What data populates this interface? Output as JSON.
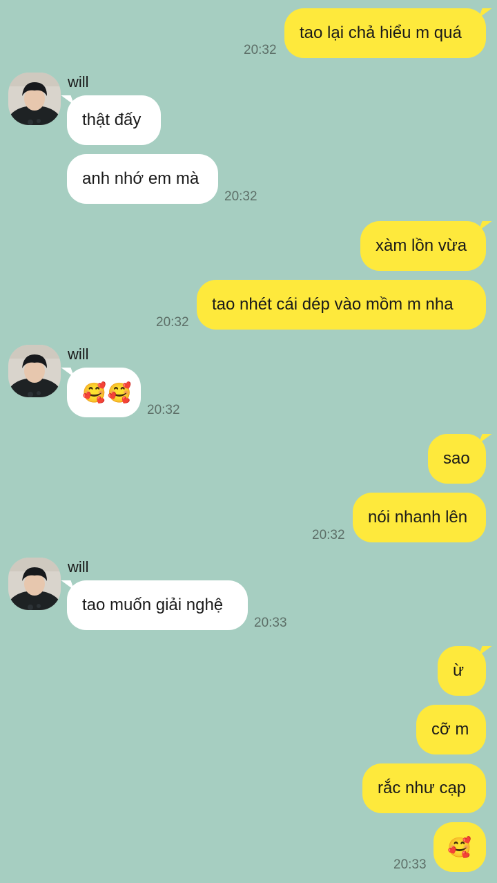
{
  "contact": {
    "name": "will"
  },
  "messages": [
    {
      "from": "me",
      "text": "tao lại chả hiểu m quá",
      "time": "20:32"
    },
    {
      "from": "will",
      "text": "thật đấy"
    },
    {
      "from": "will",
      "text": "anh nhớ em mà",
      "time": "20:32"
    },
    {
      "from": "me",
      "text": "xàm lồn vừa"
    },
    {
      "from": "me",
      "text": "tao nhét cái dép vào mồm m nha",
      "time": "20:32"
    },
    {
      "from": "will",
      "text": "🥰🥰",
      "time": "20:32"
    },
    {
      "from": "me",
      "text": "sao"
    },
    {
      "from": "me",
      "text": "nói nhanh lên",
      "time": "20:32"
    },
    {
      "from": "will",
      "text": "tao muốn giải nghệ",
      "time": "20:33"
    },
    {
      "from": "me",
      "text": "ừ"
    },
    {
      "from": "me",
      "text": "cỡ m"
    },
    {
      "from": "me",
      "text": "rắc như cạp"
    },
    {
      "from": "me",
      "text": "🥰",
      "time": "20:33"
    }
  ],
  "colors": {
    "background": "#a6cec1",
    "outgoing_bubble": "#fee93c",
    "incoming_bubble": "#ffffff",
    "timestamp": "#5d6f68"
  },
  "icons": {
    "avatar": "contact-avatar-photo"
  }
}
